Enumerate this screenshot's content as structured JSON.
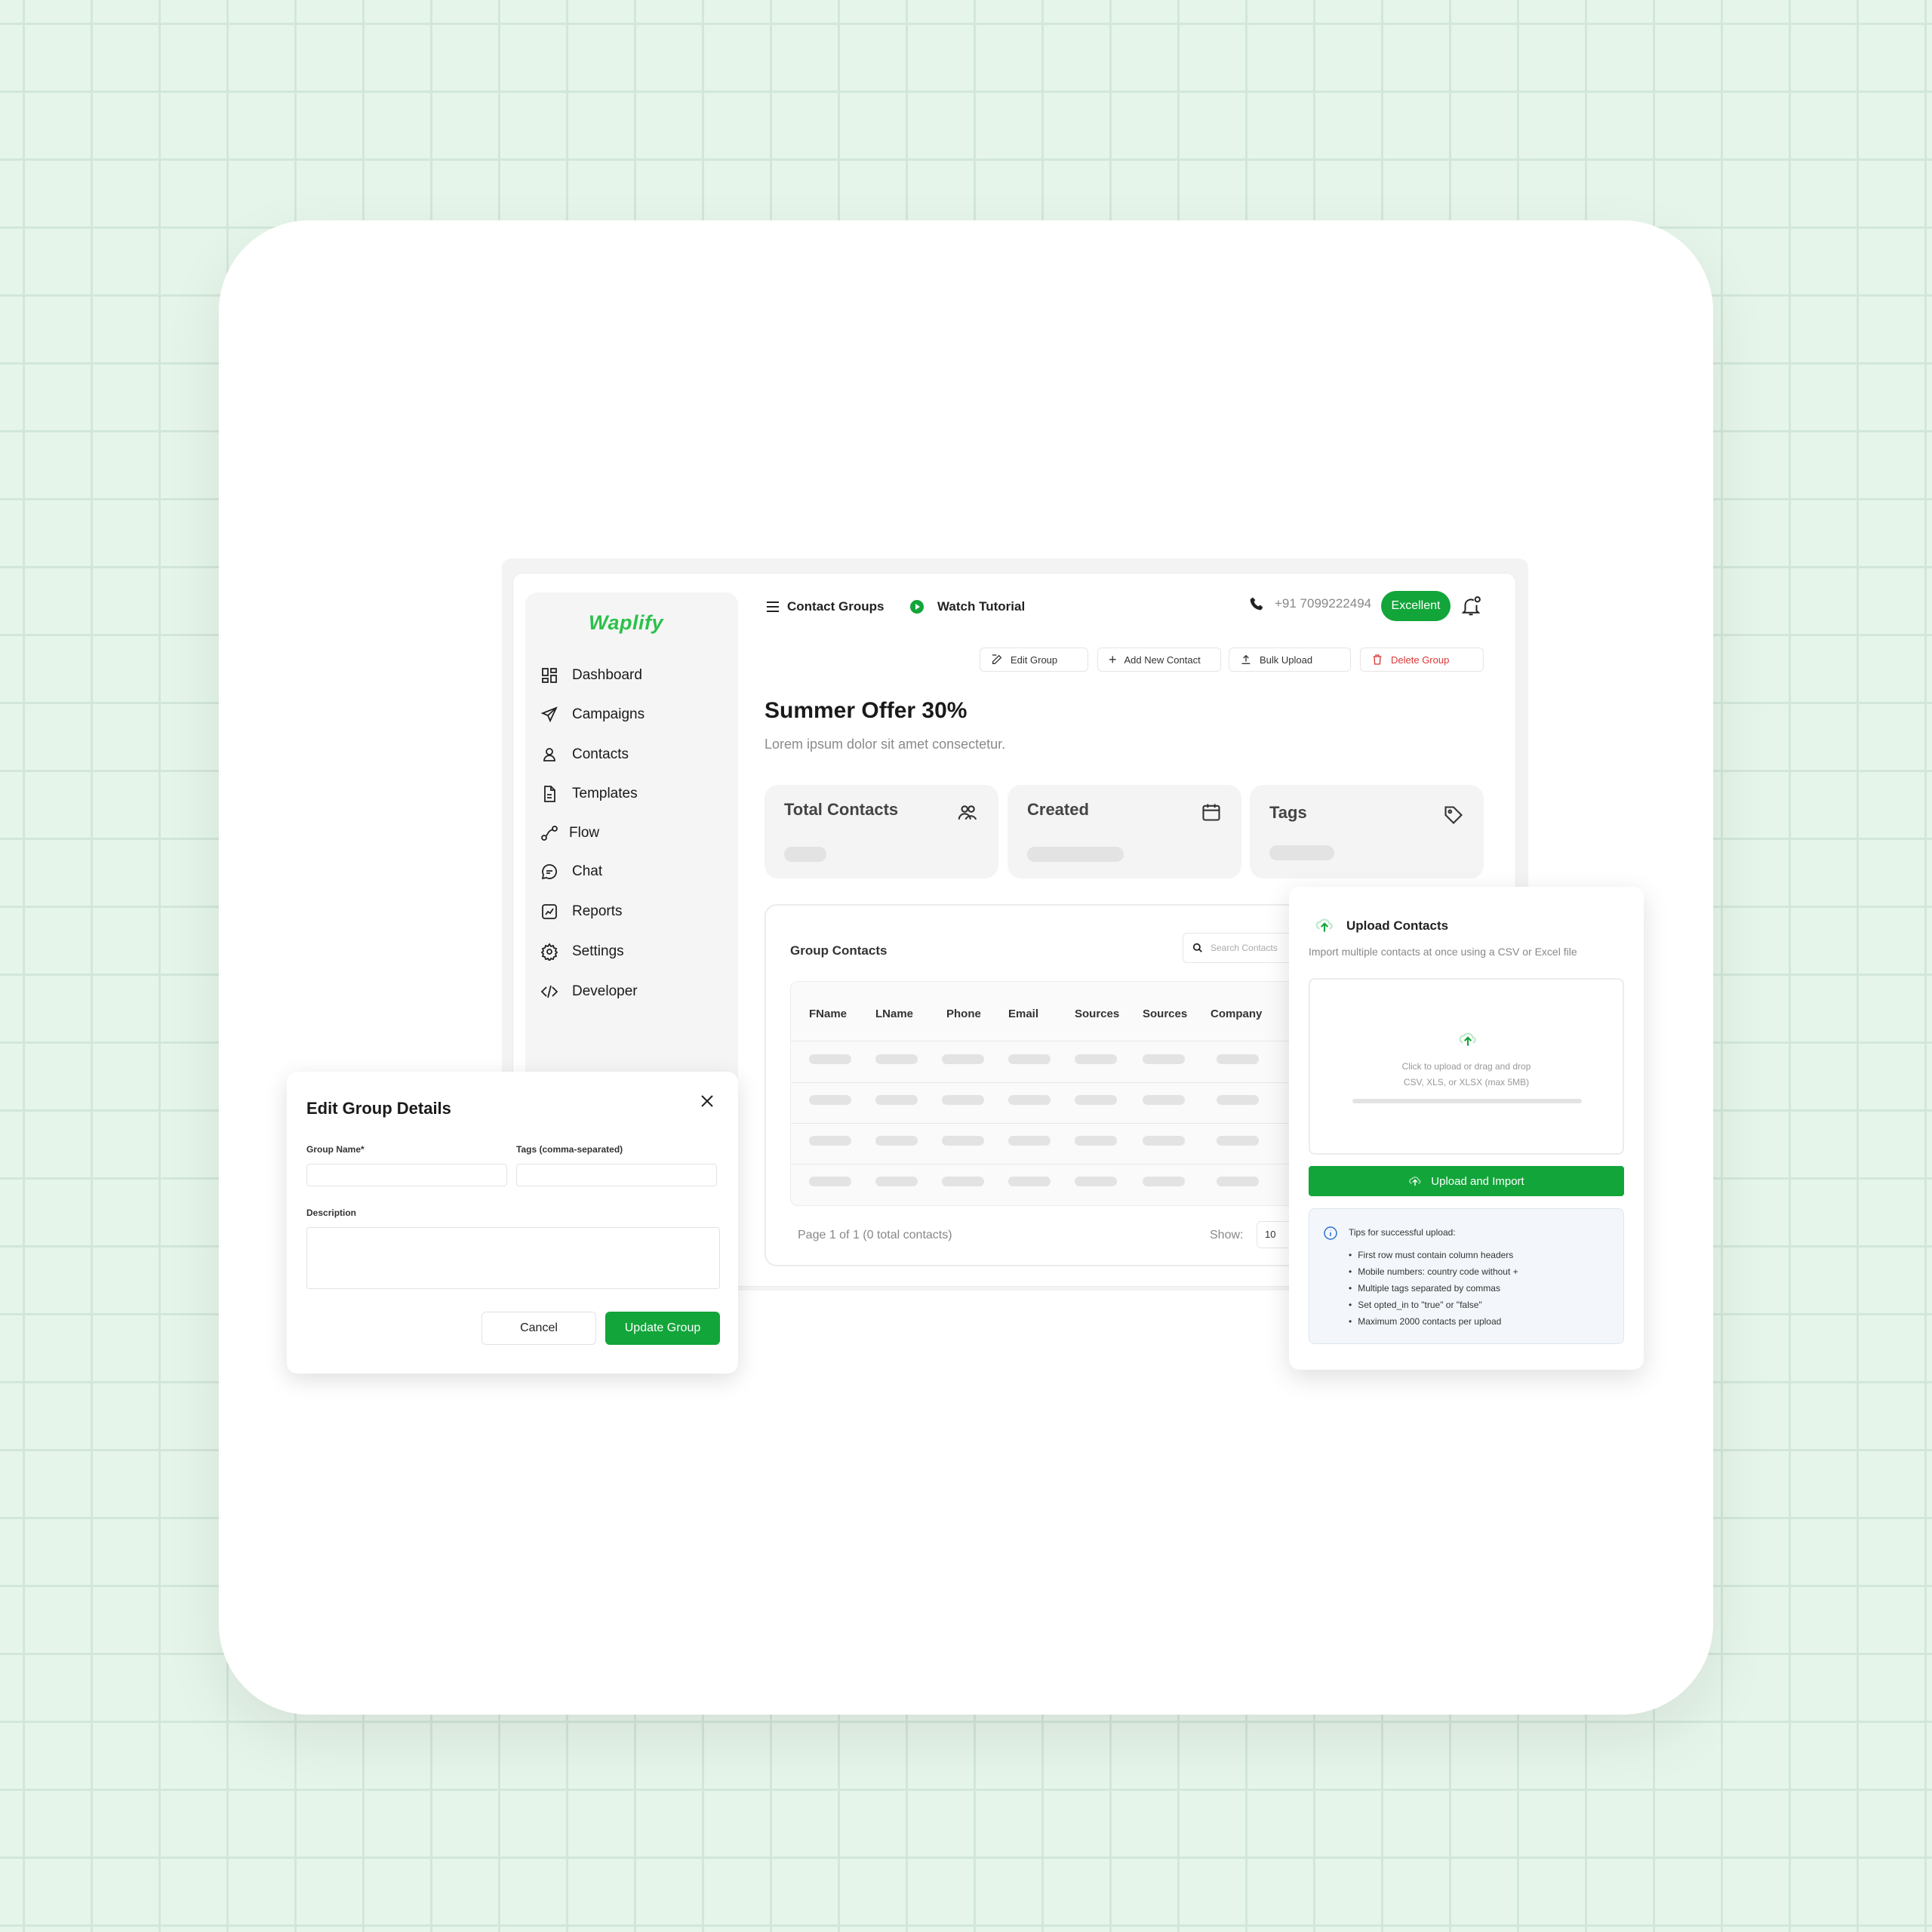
{
  "brand": {
    "logo": "Waplify",
    "accent": "#12a53a"
  },
  "sidebar": {
    "items": [
      {
        "label": "Dashboard",
        "icon": "grid-icon"
      },
      {
        "label": "Campaigns",
        "icon": "send-icon"
      },
      {
        "label": "Contacts",
        "icon": "user-icon"
      },
      {
        "label": "Templates",
        "icon": "file-icon"
      },
      {
        "label": "Flow",
        "icon": "flow-icon"
      },
      {
        "label": "Chat",
        "icon": "chat-icon"
      },
      {
        "label": "Reports",
        "icon": "chart-icon"
      },
      {
        "label": "Settings",
        "icon": "gear-icon"
      },
      {
        "label": "Developer",
        "icon": "code-icon"
      }
    ]
  },
  "topbar": {
    "contact_groups": "Contact Groups",
    "watch_tutorial": "Watch Tutorial",
    "phone": "+91 7099222494",
    "status": "Excellent"
  },
  "actions": {
    "edit_group": "Edit Group",
    "add_contact": "Add New Contact",
    "bulk_upload": "Bulk Upload",
    "delete_group": "Delete Group"
  },
  "group": {
    "title": "Summer Offer 30%",
    "description": "Lorem ipsum dolor sit amet consectetur."
  },
  "stats": {
    "total_contacts": "Total Contacts",
    "created": "Created",
    "tags": "Tags"
  },
  "table": {
    "title": "Group Contacts",
    "search_placeholder": "Search Contacts",
    "columns": [
      "FName",
      "LName",
      "Phone",
      "Email",
      "Sources",
      "Sources",
      "Company"
    ],
    "pager": "Page 1 of 1 (0 total contacts)",
    "show_label": "Show:",
    "show_value": "10"
  },
  "edit_modal": {
    "title": "Edit Group Details",
    "group_name_label": "Group Name*",
    "tags_label": "Tags (comma-separated)",
    "description_label": "Description",
    "cancel": "Cancel",
    "submit": "Update Group"
  },
  "upload_panel": {
    "title": "Upload Contacts",
    "subtitle": "Import multiple contacts at once using a CSV or Excel file",
    "drop_line1": "Click to upload or drag and drop",
    "drop_line2": "CSV, XLS, or XLSX (max 5MB)",
    "button": "Upload and Import",
    "tips_title": "Tips for successful upload:",
    "tips": [
      "First row must contain column headers",
      "Mobile numbers: country code without +",
      "Multiple tags separated by commas",
      "Set opted_in to \"true\" or \"false\"",
      "Maximum 2000 contacts per upload"
    ]
  }
}
